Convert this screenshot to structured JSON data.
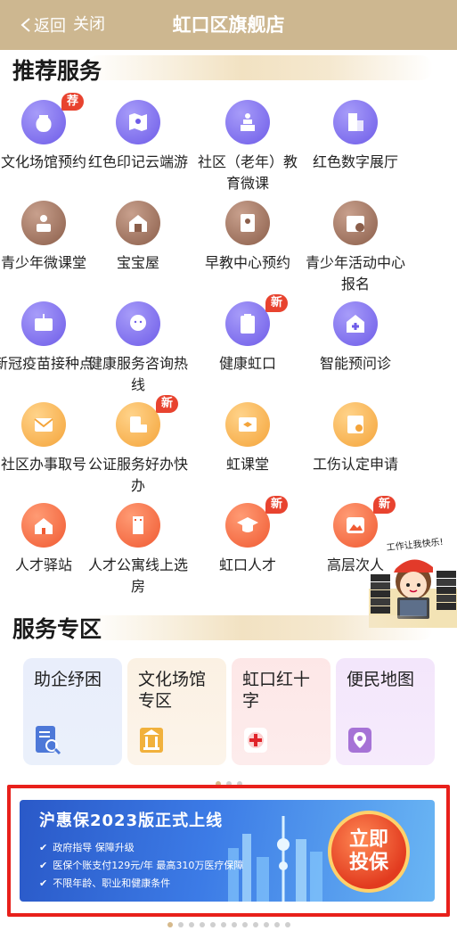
{
  "header": {
    "back_label": "返回",
    "close_label": "关闭",
    "title": "虹口区旗舰店"
  },
  "recommended": {
    "title": "推荐服务",
    "items": [
      {
        "label": "文化场馆预约",
        "badge": "荐",
        "color": "purple",
        "icon": "vase-icon"
      },
      {
        "label": "红色印记云端游",
        "badge": "",
        "color": "purple",
        "icon": "map-pin-icon"
      },
      {
        "label": "社区（老年）教育微课",
        "badge": "",
        "color": "purple",
        "icon": "lecture-icon"
      },
      {
        "label": "红色数字展厅",
        "badge": "",
        "color": "purple",
        "icon": "building-icon"
      },
      {
        "label": "青少年微课堂",
        "badge": "",
        "color": "brown",
        "icon": "classroom-icon"
      },
      {
        "label": "宝宝屋",
        "badge": "",
        "color": "brown",
        "icon": "house-icon"
      },
      {
        "label": "早教中心预约",
        "badge": "",
        "color": "brown",
        "icon": "child-card-icon"
      },
      {
        "label": "青少年活动中心报名",
        "badge": "",
        "color": "brown",
        "icon": "calendar-icon"
      },
      {
        "label": "新冠疫苗接种点",
        "badge": "",
        "color": "purple",
        "icon": "vaccine-sign-icon"
      },
      {
        "label": "健康服务咨询热线",
        "badge": "",
        "color": "purple",
        "icon": "person-face-icon"
      },
      {
        "label": "健康虹口",
        "badge": "新",
        "color": "purple",
        "icon": "clipboard-icon"
      },
      {
        "label": "智能预问诊",
        "badge": "",
        "color": "purple",
        "icon": "hospital-icon"
      },
      {
        "label": "社区办事取号",
        "badge": "",
        "color": "gold",
        "icon": "envelope-icon"
      },
      {
        "label": "公证服务好办快办",
        "badge": "新",
        "color": "gold",
        "icon": "scale-mail-icon"
      },
      {
        "label": "虹课堂",
        "badge": "",
        "color": "gold",
        "icon": "graduation-board-icon"
      },
      {
        "label": "工伤认定申请",
        "badge": "",
        "color": "gold",
        "icon": "certificate-icon"
      },
      {
        "label": "人才驿站",
        "badge": "",
        "color": "orange",
        "icon": "school-icon"
      },
      {
        "label": "人才公寓线上选房",
        "badge": "",
        "color": "orange",
        "icon": "apartment-icon"
      },
      {
        "label": "虹口人才",
        "badge": "新",
        "color": "orange",
        "icon": "grad-cap-icon"
      },
      {
        "label": "高层次人",
        "badge": "新",
        "color": "orange",
        "icon": "picture-card-icon"
      }
    ]
  },
  "mascot": {
    "caption": "工作让我快乐!"
  },
  "service_zone": {
    "title": "服务专区",
    "cards": [
      {
        "title": "助企纾困",
        "icon": "document-search-icon"
      },
      {
        "title": "文化场馆专区",
        "icon": "pavilion-icon"
      },
      {
        "title": "虹口红十字",
        "icon": "red-cross-icon"
      },
      {
        "title": "便民地图",
        "icon": "map-location-icon"
      }
    ]
  },
  "banner": {
    "title": "沪惠保2023版正式上线",
    "lines": [
      "政府指导 保障升级",
      "医保个账支付129元/年 最高310万医疗保障",
      "不限年龄、职业和健康条件"
    ],
    "cta_line1": "立即",
    "cta_line2": "投保"
  },
  "colors": {
    "header": "#cdb790",
    "badge": "#e8432f",
    "highlight_border": "#e8201b"
  }
}
